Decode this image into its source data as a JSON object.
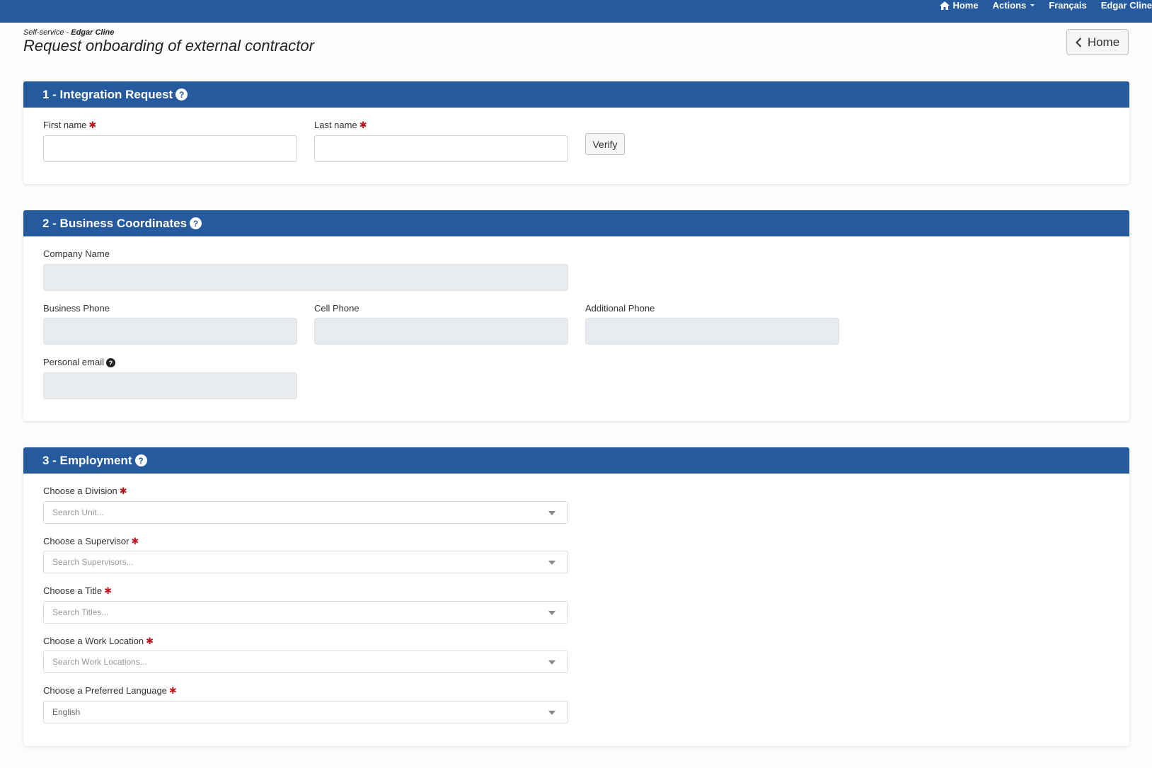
{
  "topnav": {
    "home": "Home",
    "actions": "Actions",
    "language": "Français",
    "user": "Edgar Cline"
  },
  "header": {
    "crumb_prefix": "Self-service - ",
    "crumb_user": "Edgar Cline",
    "title": "Request onboarding of external contractor",
    "home_button": "Home"
  },
  "section1": {
    "title": "1 - Integration Request",
    "first_name_label": "First name",
    "last_name_label": "Last name",
    "first_name_value": "",
    "last_name_value": "",
    "verify_button": "Verify"
  },
  "section2": {
    "title": "2 - Business Coordinates",
    "company_label": "Company Name",
    "business_phone_label": "Business Phone",
    "cell_phone_label": "Cell Phone",
    "additional_phone_label": "Additional Phone",
    "personal_email_label": "Personal email"
  },
  "section3": {
    "title": "3 - Employment",
    "division_label": "Choose a Division",
    "division_placeholder": "Search Unit...",
    "supervisor_label": "Choose a Supervisor",
    "supervisor_placeholder": "Search Supervisors...",
    "title_label": "Choose a Title",
    "title_placeholder": "Search Titles...",
    "location_label": "Choose a Work Location",
    "location_placeholder": "Search Work Locations...",
    "language_label": "Choose a Preferred Language",
    "language_value": "English"
  },
  "colors": {
    "brand": "#255b9e",
    "required": "#c0141e"
  }
}
